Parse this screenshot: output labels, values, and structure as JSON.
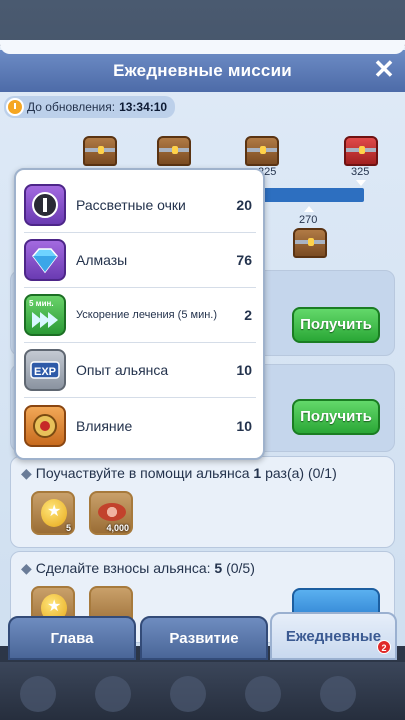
{
  "header": {
    "title": "Ежедневные миссии",
    "close_icon": "close-icon"
  },
  "timer": {
    "label": "До обновления:",
    "value": "13:34:10"
  },
  "milestones": [
    {
      "value": "",
      "chest": "bronze"
    },
    {
      "value": "",
      "chest": "bronze"
    },
    {
      "value": "225",
      "chest": "bronze"
    },
    {
      "value": "270",
      "chest": "bronze"
    },
    {
      "value": "325",
      "chest": "red"
    }
  ],
  "tooltip": {
    "items": [
      {
        "label": "Рассветные очки",
        "value": "20",
        "icon": "dawn-points-icon"
      },
      {
        "label": "Алмазы",
        "value": "76",
        "icon": "diamond-icon"
      },
      {
        "label": "Ускорение лечения (5 мин.)",
        "value": "2",
        "icon": "heal-speedup-icon",
        "badge": "5 мин."
      },
      {
        "label": "Опыт альянса",
        "value": "10",
        "icon": "alliance-exp-icon",
        "badge": "EXP"
      },
      {
        "label": "Влияние",
        "value": "10",
        "icon": "influence-icon"
      }
    ]
  },
  "missions": [
    {
      "button": "Получить"
    },
    {
      "button": "Получить"
    },
    {
      "text": "Поучаствуйте в помощи альянса",
      "bold": "1",
      "suffix": "раз(а) (0/1)",
      "rewards": [
        {
          "icon": "gold-medal-icon",
          "count": "5"
        },
        {
          "icon": "meat-icon",
          "count": "4,000"
        }
      ]
    },
    {
      "text": "Сделайте взносы альянса:",
      "bold": "5",
      "suffix": "(0/5)",
      "rewards": [
        {
          "icon": "gold-medal-icon",
          "count": ""
        },
        {
          "icon": "wood-icon",
          "count": ""
        }
      ]
    }
  ],
  "tabs": [
    {
      "label": "Глава",
      "active": false
    },
    {
      "label": "Развитие",
      "active": false
    },
    {
      "label": "Ежедневные",
      "active": true,
      "badge": "2"
    }
  ],
  "colors": {
    "title_bar": "#5a79b5",
    "accept_green": "#2aa736",
    "progress_blue": "#2d6fc0",
    "badge_red": "#e02828"
  }
}
